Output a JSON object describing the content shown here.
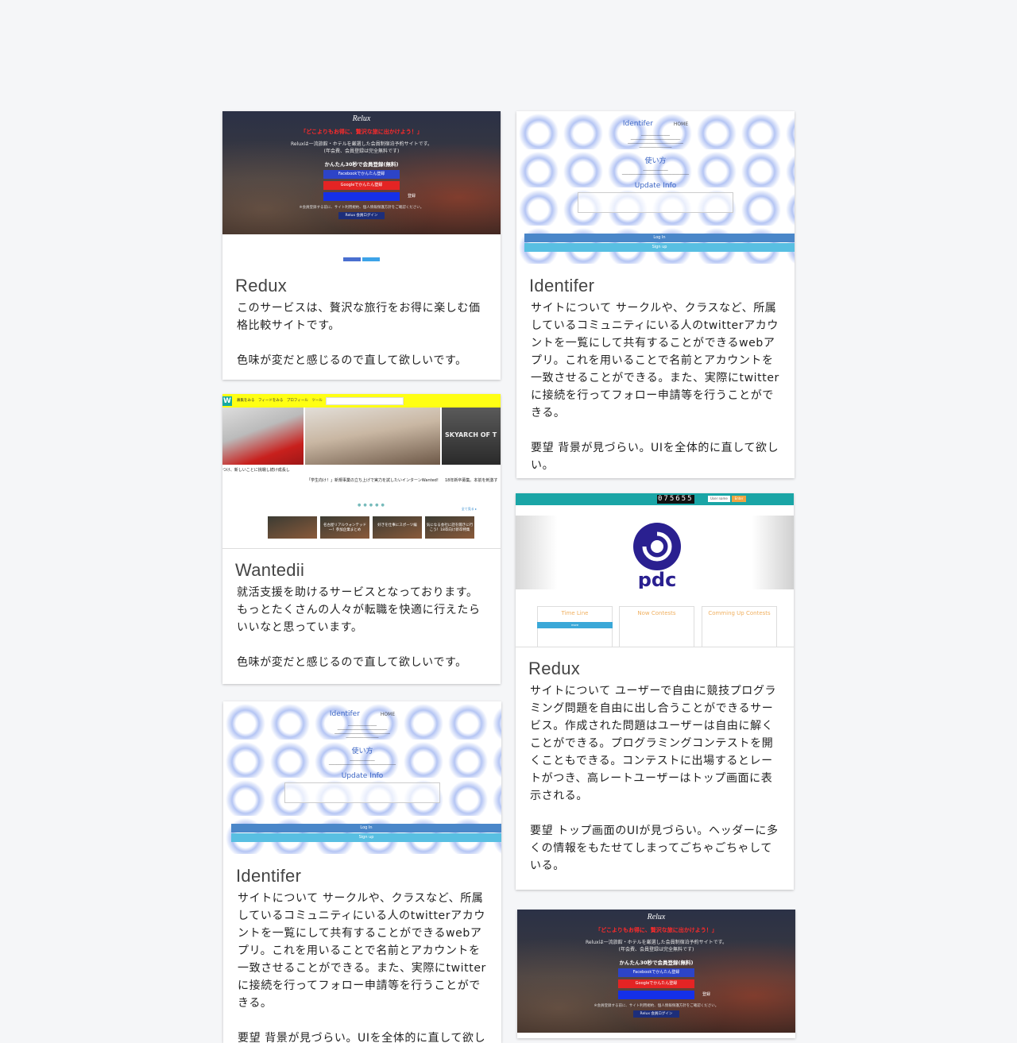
{
  "cards": [
    {
      "title": "Redux",
      "description": "このサービスは、贅沢な旅行をお得に楽しむ価格比較サイトです。\n\n色味が変だと感じるので直して欲しいです。",
      "screenshot": {
        "logo": "Relux",
        "catchphrase": "「どこよりもお得に、贅沢な旅に出かけよう！」",
        "desc_line1": "Reluxは一流旅館・ホテルを厳選した会員制宿泊予約サイトです。",
        "desc_line2": "(年会費、会員登録は完全無料です)",
        "register_heading": "かんたん30秒で会員登録(無料)",
        "facebook_button": "Facebookでかんたん登録",
        "google_button": "Googleでかんたん登録",
        "email_register": "登録",
        "terms_note": "※会員登録する前に、サイト利用規約、個人情報保護方針をご確認ください。",
        "login_button": "Relux 会員ログイン"
      }
    },
    {
      "title": "Identifer",
      "description": "サイトについて サークルや、クラスなど、所属しているコミュニティにいる人のtwitterアカウントを一覧にして共有することができるwebアプリ。これを用いることで名前とアカウントを一致させることができる。また、実際にtwitterに接続を行ってフォロー申請等を行うことができる。\n\n要望 背景が見づらい。UIを全体的に直して欲しい。",
      "screenshot": {
        "brand": "Identifer",
        "nav_home": "HOME",
        "heading_usage": "使い方",
        "heading_update": "Update Info",
        "login_button": "Log In",
        "signup_button": "Sign up"
      }
    },
    {
      "title": "Wantedii",
      "description": "就活支援を助けるサービスとなっております。もっとたくさんの人々が転職を快適に行えたらいいなと思っています。\n\n色味が変だと感じるので直して欲しいです。",
      "screenshot": {
        "logo": "W",
        "menu": "募集をみる　フィードをみる　プロフィール　ツール",
        "banner_text": "SKYARCH OF T",
        "card1_text": "つけ、新しいことに挑戦し続け成長し",
        "card2_text": "「学生向け！」新規事業の立ち上げで実力を試したいインターンWanted!",
        "card3_text": "18年新卒募集。本前を刺激す",
        "more_link": "全て見る ▸",
        "thumb1": "",
        "thumb2": "名古屋リアルウォンテッド一！参加企業まとめ",
        "thumb3": "好きを仕事にスポーツ編",
        "thumb4": "気になる会社に話を聞きに行こう！18卒向け新卒特集"
      }
    },
    {
      "title": "Redux",
      "description": "サイトについて ユーザーで自由に競技プログラミング問題を自由に出し合うことができるサービス。作成された問題はユーザーは自由に解くことができる。プログラミングコンテストを開くこともできる。コンテストに出場するとレートがつき、高レートユーザーはトップ画面に表示される。\n\n要望 トップ画面のUIが見づらい。ヘッダーに多くの情報をもたせてしまってごちゃごちゃしている。",
      "screenshot": {
        "counter": "075655",
        "login_placeholder": "User name",
        "cta": "Enter",
        "logo_text": "pdc",
        "col1": "Time Line",
        "col2": "Now Contests",
        "col3": "Comming Up Contests",
        "more_button": "more"
      }
    },
    {
      "title": "Identifer",
      "description": "サイトについて サークルや、クラスなど、所属しているコミュニティにいる人のtwitterアカウントを一覧にして共有することができるwebアプリ。これを用いることで名前とアカウントを一致させることができる。また、実際にtwitterに接続を行ってフォロー申請等を行うことができる。\n\n要望 背景が見づらい。UIを全体的に直して欲しい。",
      "screenshot": {
        "brand": "Identifer",
        "nav_home": "HOME",
        "heading_usage": "使い方",
        "heading_update": "Update Info",
        "login_button": "Log In",
        "signup_button": "Sign up"
      }
    },
    {
      "title": "",
      "description": "",
      "screenshot": {
        "logo": "Relux",
        "catchphrase": "「どこよりもお得に、贅沢な旅に出かけよう！」",
        "desc_line1": "Reluxは一流旅館・ホテルを厳選した会員制宿泊予約サイトです。",
        "desc_line2": "(年会費、会員登録は完全無料です)",
        "register_heading": "かんたん30秒で会員登録(無料)",
        "facebook_button": "Facebookでかんたん登録",
        "google_button": "Googleでかんたん登録",
        "email_register": "登録",
        "terms_note": "※会員登録する前に、サイト利用規約、個人情報保護方針をご確認ください。",
        "login_button": "Relux 会員ログイン"
      }
    }
  ],
  "colors": {
    "background": "#f5f6f8",
    "card": "#ffffff",
    "relux_catch": "#ff2a2a",
    "identifer_accent": "#3a64c4",
    "wantedii_bar": "#ffff14",
    "pdc_bar": "#1aa5a6"
  }
}
